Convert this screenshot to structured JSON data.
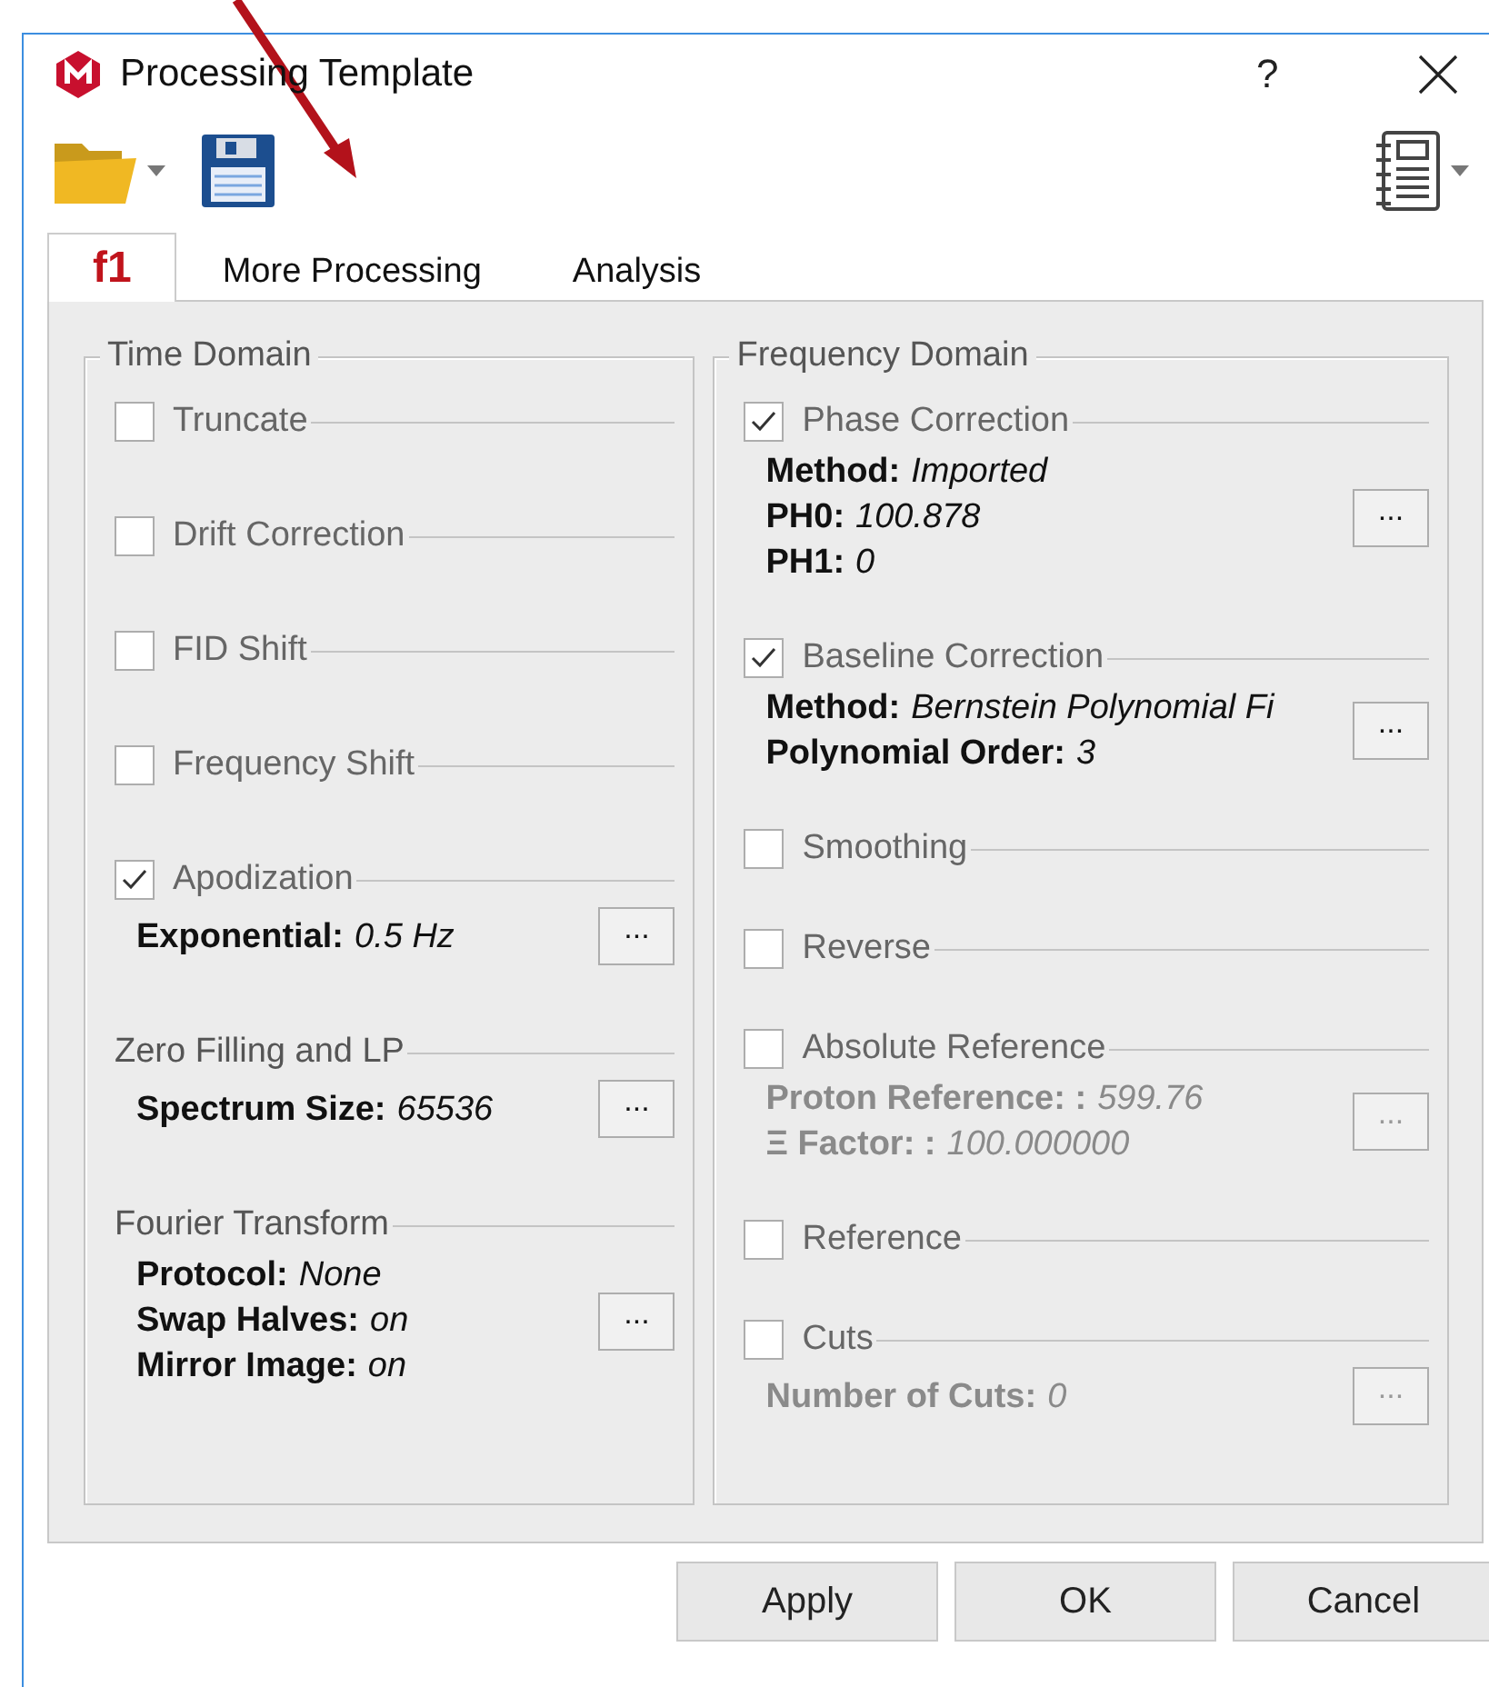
{
  "window": {
    "title": "Processing Template",
    "help": "?"
  },
  "tabs": [
    {
      "label": "f1",
      "selected": true
    },
    {
      "label": "More Processing",
      "selected": false
    },
    {
      "label": "Analysis",
      "selected": false
    }
  ],
  "left_panel": {
    "title": "Time Domain",
    "sections": [
      {
        "kind": "check",
        "label": "Truncate",
        "checked": false
      },
      {
        "kind": "check",
        "label": "Drift Correction",
        "checked": false
      },
      {
        "kind": "check",
        "label": "FID Shift",
        "checked": false
      },
      {
        "kind": "check",
        "label": "Frequency Shift",
        "checked": false
      },
      {
        "kind": "check",
        "label": "Apodization",
        "checked": true,
        "disabled": false,
        "fields": [
          {
            "name": "Exponential:",
            "value": "0.5 Hz"
          }
        ],
        "button": "..."
      },
      {
        "kind": "heading",
        "label": "Zero Filling and LP",
        "disabled": false,
        "fields": [
          {
            "name": "Spectrum Size:",
            "value": "65536"
          }
        ],
        "button": "..."
      },
      {
        "kind": "heading",
        "label": "Fourier Transform",
        "disabled": false,
        "fields": [
          {
            "name": "Protocol:",
            "value": "None"
          },
          {
            "name": "Swap Halves:",
            "value": "on"
          },
          {
            "name": "Mirror Image:",
            "value": "on"
          }
        ],
        "button": "..."
      }
    ]
  },
  "right_panel": {
    "title": "Frequency Domain",
    "sections": [
      {
        "kind": "check",
        "label": "Phase Correction",
        "checked": true,
        "disabled": false,
        "fields": [
          {
            "name": "Method:",
            "value": "Imported"
          },
          {
            "name": "PH0:",
            "value": "100.878"
          },
          {
            "name": "PH1:",
            "value": "0"
          }
        ],
        "button": "..."
      },
      {
        "kind": "check",
        "label": "Baseline Correction",
        "checked": true,
        "disabled": false,
        "fields": [
          {
            "name": "Method:",
            "value": "Bernstein Polynomial Fi"
          },
          {
            "name": "Polynomial Order:",
            "value": "3"
          }
        ],
        "button": "..."
      },
      {
        "kind": "check",
        "label": "Smoothing",
        "checked": false
      },
      {
        "kind": "check",
        "label": "Reverse",
        "checked": false
      },
      {
        "kind": "check",
        "label": "Absolute Reference",
        "checked": false,
        "disabled": true,
        "fields": [
          {
            "name": "Proton Reference: :",
            "value": "599.76"
          },
          {
            "name": "Ξ Factor: :",
            "value": "100.000000"
          }
        ],
        "button": "..."
      },
      {
        "kind": "check",
        "label": "Reference",
        "checked": false
      },
      {
        "kind": "check",
        "label": "Cuts",
        "checked": false,
        "disabled": true,
        "fields": [
          {
            "name": "Number of Cuts:",
            "value": "0"
          }
        ],
        "button": "..."
      }
    ]
  },
  "buttons": [
    "Apply",
    "OK",
    "Cancel"
  ]
}
